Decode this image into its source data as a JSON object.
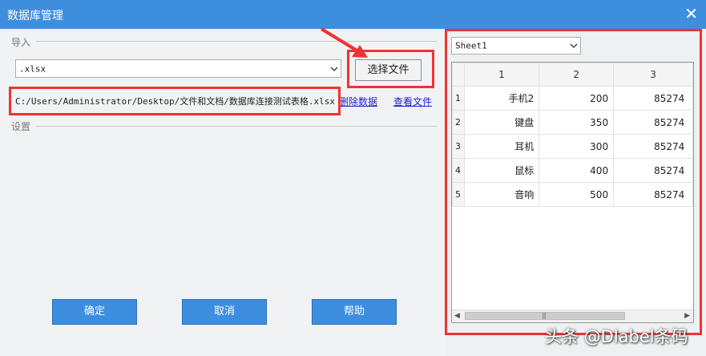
{
  "window": {
    "title": "数据库管理",
    "close_icon": "✕"
  },
  "import_section": {
    "label": "导入"
  },
  "settings_section": {
    "label": "设置"
  },
  "file_type": {
    "value": ".xlsx"
  },
  "choose_file_button": "选择文件",
  "file_path": "C:/Users/Administrator/Desktop/文件和文档/数据库连接测试表格.xlsx",
  "links": {
    "delete_data": "删除数据",
    "view_file": "查看文件"
  },
  "buttons": {
    "confirm": "确定",
    "cancel": "取消",
    "help": "帮助"
  },
  "sheet_select": {
    "value": "Sheet1"
  },
  "grid": {
    "columns": [
      "1",
      "2",
      "3"
    ],
    "rows": [
      {
        "num": "1",
        "c1": "手机2",
        "c2": "200",
        "c3": "85274"
      },
      {
        "num": "2",
        "c1": "键盘",
        "c2": "350",
        "c3": "85274"
      },
      {
        "num": "3",
        "c1": "耳机",
        "c2": "300",
        "c3": "85274"
      },
      {
        "num": "4",
        "c1": "鼠标",
        "c2": "400",
        "c3": "85274"
      },
      {
        "num": "5",
        "c1": "音响",
        "c2": "500",
        "c3": "85274"
      }
    ],
    "scroll_grip": "|||"
  },
  "watermark": "头条 @Dlabel条码",
  "colors": {
    "titlebar": "#3e8ede",
    "button": "#3d8edf",
    "highlight": "#ee3333",
    "link": "#1f1fcf"
  }
}
